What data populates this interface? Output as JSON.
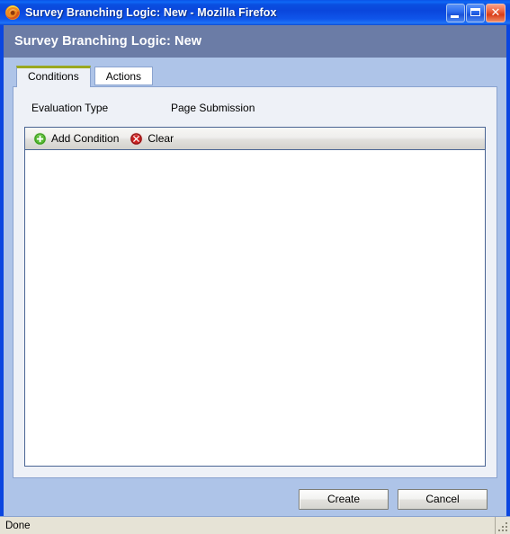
{
  "window": {
    "titlebar": {
      "icon": "firefox-logo-icon",
      "title": "Survey Branching Logic: New - Mozilla Firefox",
      "minimize_label": "Minimize",
      "maximize_label": "Maximize",
      "close_label": "Close"
    },
    "header": {
      "page_title": "Survey Branching Logic: New"
    },
    "tabs": [
      {
        "label": "Conditions",
        "active": true
      },
      {
        "label": "Actions",
        "active": false
      }
    ],
    "conditions_panel": {
      "field": {
        "label": "Evaluation Type",
        "value": "Page Submission"
      },
      "toolbar": [
        {
          "label": "Add Condition",
          "icon": "add-plus-green-icon"
        },
        {
          "label": "Clear",
          "icon": "delete-x-red-icon"
        }
      ],
      "list_items": []
    },
    "footer_buttons": [
      {
        "label": "Create"
      },
      {
        "label": "Cancel"
      }
    ],
    "statusbar": {
      "text": "Done",
      "grip": "resize-grip"
    }
  },
  "colors": {
    "titlebar_blue": "#0a46dc",
    "window_border": "#0a46e0",
    "header_band": "#6b7ca6",
    "content_backdrop": "#aec4e8",
    "panel_bg": "#eef1f7",
    "panel_border": "#8aa3cf",
    "active_tab_top": "#9aa820",
    "condbox_border": "#4a6593",
    "list_bg": "#ffffff",
    "statusbar_bg": "#e6e3d6",
    "add_icon_green": "#4caf28",
    "clear_icon_red": "#cc2020"
  }
}
